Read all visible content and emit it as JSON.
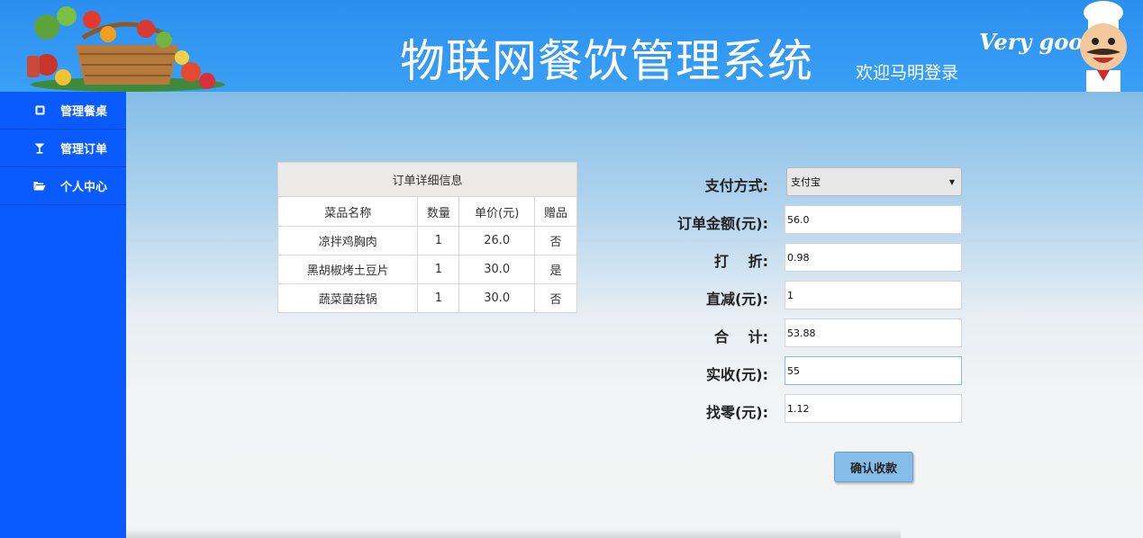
{
  "header": {
    "title": "物联网餐饮管理系统",
    "welcome": "欢迎马明登录",
    "slogan": "Very good"
  },
  "sidebar": {
    "items": [
      {
        "label": "管理餐桌",
        "icon": "table-icon"
      },
      {
        "label": "管理订单",
        "icon": "cocktail-glass-icon"
      },
      {
        "label": "个人中心",
        "icon": "folder-open-icon"
      }
    ]
  },
  "order_table": {
    "caption": "订单详细信息",
    "columns": [
      "菜品名称",
      "数量",
      "单价(元)",
      "赠品"
    ],
    "rows": [
      [
        "凉拌鸡胸肉",
        "1",
        "26.0",
        "否"
      ],
      [
        "黑胡椒烤土豆片",
        "1",
        "30.0",
        "是"
      ],
      [
        "蔬菜菌菇锅",
        "1",
        "30.0",
        "否"
      ]
    ]
  },
  "payment": {
    "method_label": "支付方式:",
    "method_value": "支付宝",
    "fields": [
      {
        "label": "订单金额(元):",
        "value": "56.0"
      },
      {
        "label": "打　 折:",
        "value": "0.98"
      },
      {
        "label": "直减(元):",
        "value": "1"
      },
      {
        "label": "合　 计:",
        "value": "53.88"
      },
      {
        "label": "实收(元):",
        "value": "55"
      },
      {
        "label": "找零(元):",
        "value": "1.12"
      }
    ],
    "confirm_label": "确认收款"
  },
  "colors": {
    "header": "#2a8ff0",
    "sidebar": "#0a5bff",
    "button": "#85bde8"
  }
}
